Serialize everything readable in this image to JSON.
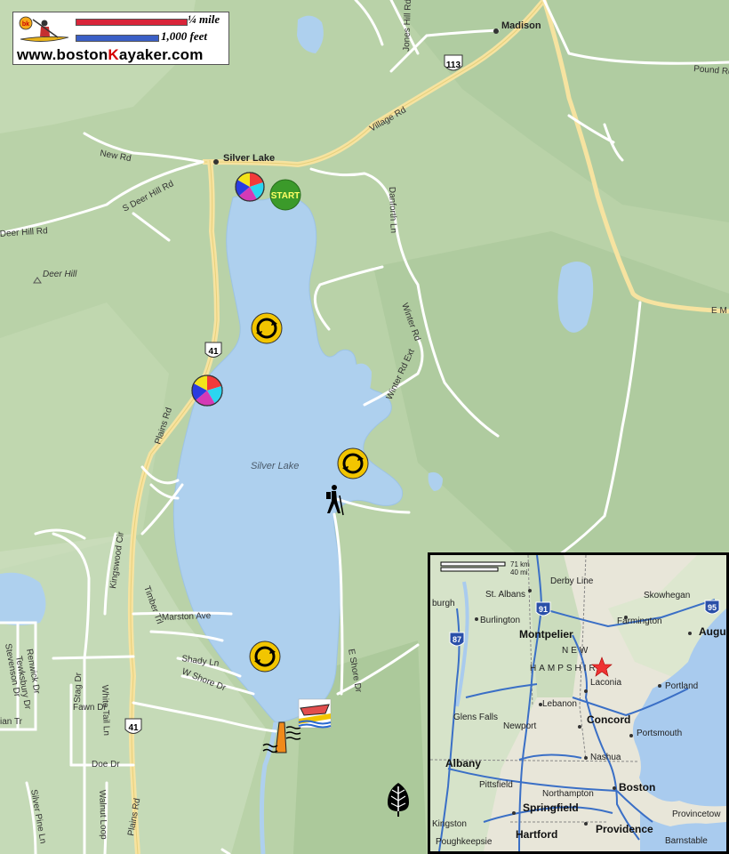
{
  "header": {
    "scale_quarter_mile": "¼ mile",
    "scale_feet": "1,000 feet",
    "site_url_prefix": "www.boston",
    "site_url_k": "K",
    "site_url_suffix": "ayaker.com"
  },
  "places": {
    "silver_lake_village": "Silver Lake",
    "madison": "Madison",
    "deer_hill": "Deer Hill",
    "lake_name": "Silver Lake"
  },
  "roads": {
    "jones_hill": "Jones Hill Rd",
    "village_rd": "Village Rd",
    "pound_rd": "Pound Rd",
    "new_rd": "New Rd",
    "s_deer_hill": "S Deer Hill Rd",
    "deer_hill_rd": "Deer Hill Rd",
    "danforth": "Danforth Ln",
    "winter_rd": "Winter Rd",
    "winter_rd_ext": "Winter Rd Ext",
    "e_m": "E M",
    "plains_rd_north": "Plains Rd",
    "plains_rd_south": "Plains Rd",
    "kingswood": "Kingswood Cir",
    "timber": "Timber Trl",
    "marston": "Marston Ave",
    "shady": "Shady Ln",
    "w_shore": "W Shore Dr",
    "e_shore": "E Shore Dr",
    "stag": "Stag Dr",
    "white_tail": "White Tail Ln",
    "fawn": "Fawn Dr",
    "doe": "Doe Dr",
    "walnut_loop": "Walnut Loop",
    "silver_pine": "Silver Pine Ln",
    "renwick": "Renwick Dr",
    "tewksbury": "Tewksbury Dr",
    "stevenson": "Stevenson Dr",
    "lan": "ian Tr"
  },
  "shields": {
    "route_113": "113",
    "route_41_north": "41",
    "route_41_south": "41"
  },
  "markers": {
    "start_label": "START",
    "icons": [
      "beach-ball-icon",
      "start-icon",
      "lookout-icon",
      "hiker-icon",
      "boat-launch-icon",
      "dam-icon",
      "tree-icon"
    ]
  },
  "inset": {
    "scale_km": "71 km",
    "scale_mi": "40 mi",
    "cities": {
      "derby_line": "Derby Line",
      "st_albans": "St. Albans",
      "burlington": "Burlington",
      "montpelier": "Montpelier",
      "skowhegan": "Skowhegan",
      "farmington": "Farmington",
      "augusta": "Augu",
      "burgh": "burgh",
      "new": "NEW",
      "hampshire": "HAMPSHIRE",
      "laconia": "Laconia",
      "lebanon": "Lebanon",
      "portland": "Portland",
      "glens_falls": "Glens Falls",
      "newport": "Newport",
      "concord": "Concord",
      "portsmouth": "Portsmouth",
      "albany": "Albany",
      "nashua": "Nashua",
      "pittsfield": "Pittsfield",
      "northampton": "Northampton",
      "boston": "Boston",
      "kingston": "Kingston",
      "springfield": "Springfield",
      "provincetown": "Provincetow",
      "poughkeepsie": "Poughkeepsie",
      "hartford": "Hartford",
      "providence": "Providence",
      "barnstable": "Barnstable"
    },
    "interstates": {
      "i91": "91",
      "i87": "87",
      "i95": "95"
    }
  },
  "colors": {
    "lake": "#aed0ee",
    "land": "#b7d1a6",
    "road": "#ffffff",
    "major_road": "#f6e6a6",
    "shield_bg": "#ffffff",
    "start_green": "#3b9a2a",
    "lookout_yellow": "#f2c500"
  }
}
